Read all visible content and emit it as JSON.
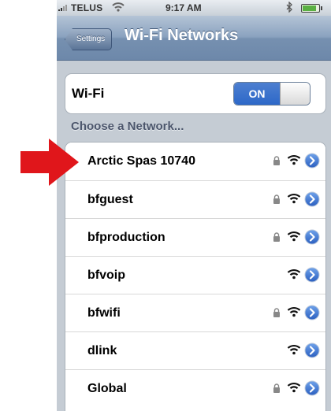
{
  "status_bar": {
    "carrier": "TELUS",
    "time": "9:17 AM"
  },
  "nav": {
    "back_label": "Settings",
    "title": "Wi-Fi Networks"
  },
  "wifi": {
    "label": "Wi-Fi",
    "toggle_state": "ON"
  },
  "section": {
    "header": "Choose a Network..."
  },
  "networks": [
    {
      "name": "Arctic Spas 10740",
      "secured": true
    },
    {
      "name": "bfguest",
      "secured": true
    },
    {
      "name": "bfproduction",
      "secured": true
    },
    {
      "name": "bfvoip",
      "secured": false
    },
    {
      "name": "bfwifi",
      "secured": true
    },
    {
      "name": "dlink",
      "secured": false
    },
    {
      "name": "Global",
      "secured": true
    }
  ],
  "icons": {
    "annotation": "red-arrow-icon",
    "lock": "lock-icon",
    "signal": "wifi-signal-icon",
    "detail": "detail-disclosure-icon"
  },
  "colors": {
    "accent": "#2d68c8",
    "annotation": "#e0161b",
    "nav": "#7690b0"
  }
}
